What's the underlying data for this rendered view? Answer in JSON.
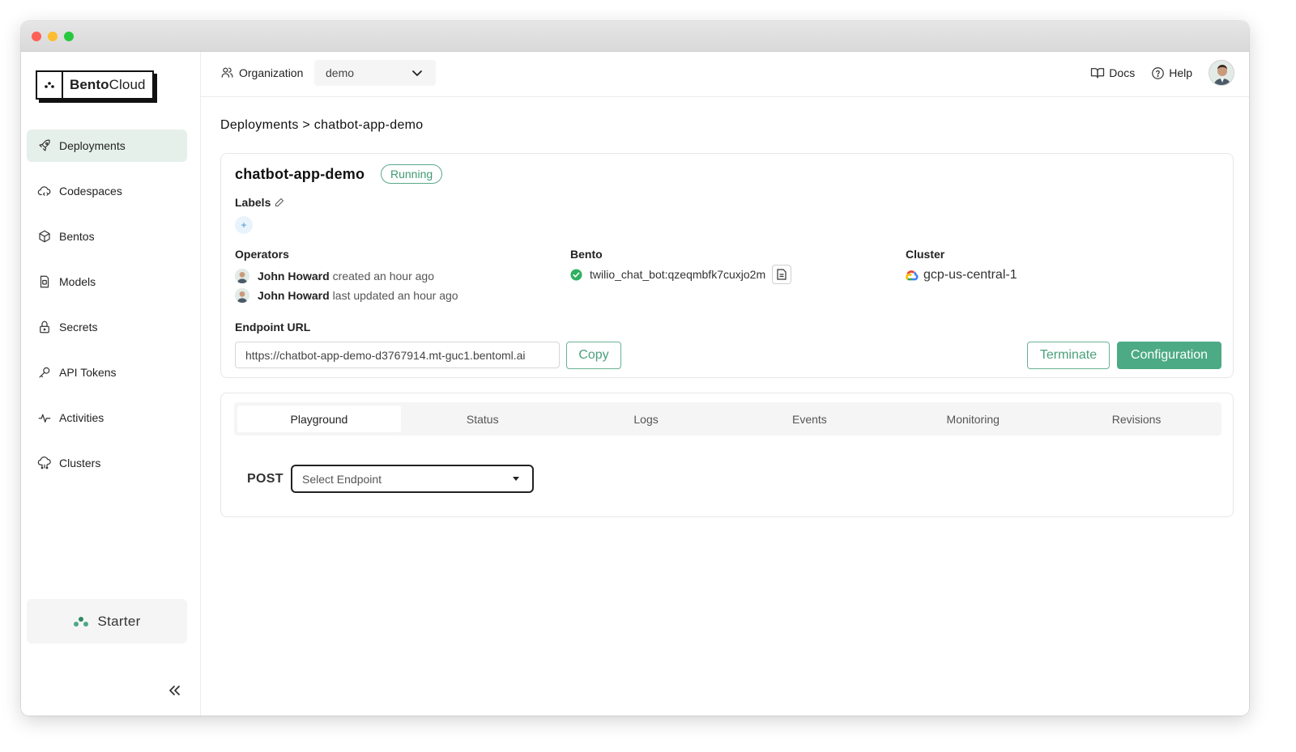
{
  "app": {
    "logo_bold": "Bento",
    "logo_rest": "Cloud",
    "plan": "Starter"
  },
  "sidebar": {
    "items": [
      {
        "label": "Deployments",
        "icon": "rocket-icon",
        "active": true
      },
      {
        "label": "Codespaces",
        "icon": "cloud-code-icon"
      },
      {
        "label": "Bentos",
        "icon": "box-icon"
      },
      {
        "label": "Models",
        "icon": "model-file-icon"
      },
      {
        "label": "Secrets",
        "icon": "lock-icon"
      },
      {
        "label": "API Tokens",
        "icon": "key-icon"
      },
      {
        "label": "Activities",
        "icon": "activity-icon"
      },
      {
        "label": "Clusters",
        "icon": "cluster-icon"
      }
    ]
  },
  "topbar": {
    "org_label": "Organization",
    "org_value": "demo",
    "docs": "Docs",
    "help": "Help"
  },
  "breadcrumb": "Deployments > chatbot-app-demo",
  "deployment": {
    "name": "chatbot-app-demo",
    "status": "Running",
    "labels_title": "Labels",
    "add_label": "+",
    "operators_title": "Operators",
    "operators": [
      {
        "name": "John Howard",
        "action": "created an hour ago"
      },
      {
        "name": "John Howard",
        "action": "last updated an hour ago"
      }
    ],
    "bento_title": "Bento",
    "bento_value": "twilio_chat_bot:qzeqmbfk7cuxjo2m",
    "cluster_title": "Cluster",
    "cluster_value": "gcp-us-central-1",
    "endpoint_title": "Endpoint URL",
    "endpoint_url": "https://chatbot-app-demo-d3767914.mt-guc1.bentoml.ai",
    "copy_label": "Copy",
    "terminate_label": "Terminate",
    "configuration_label": "Configuration"
  },
  "tabs": [
    "Playground",
    "Status",
    "Logs",
    "Events",
    "Monitoring",
    "Revisions"
  ],
  "playground": {
    "method": "POST",
    "endpoint_placeholder": "Select Endpoint"
  },
  "colors": {
    "accent": "#4caa84",
    "active_nav": "#e6f0ea",
    "status": "#3f9a74"
  }
}
